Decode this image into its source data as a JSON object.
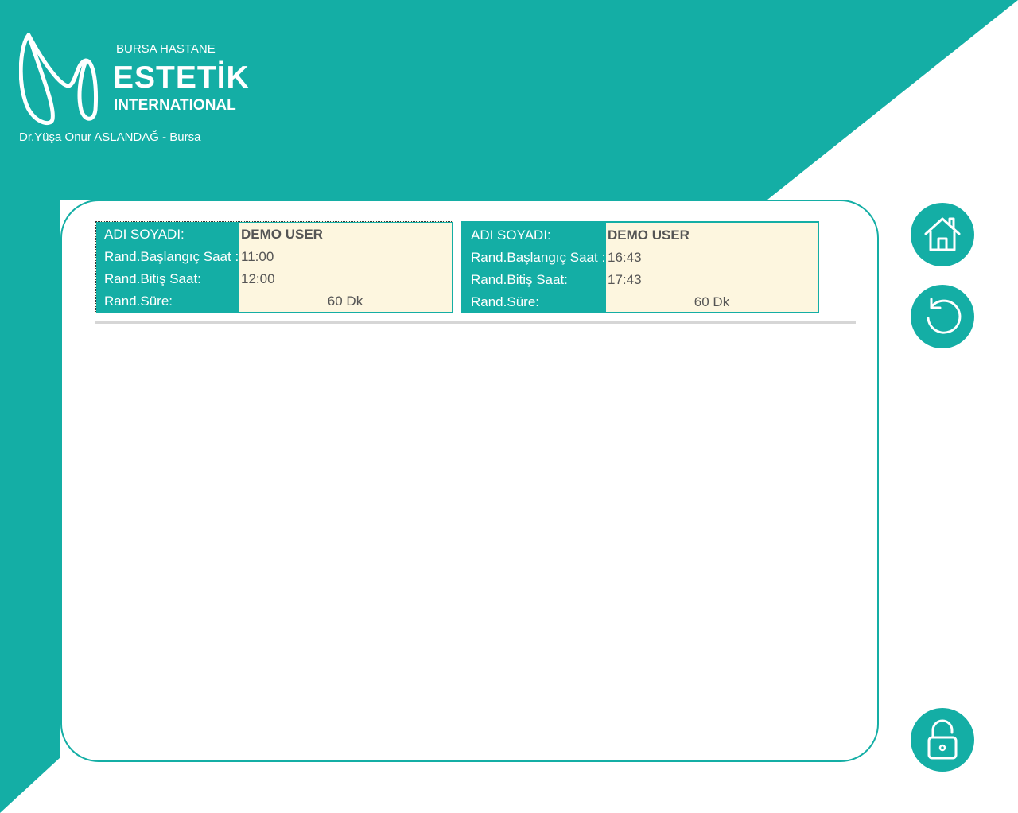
{
  "theme": {
    "primary": "#14aea5",
    "value_bg": "#fdf6df",
    "text_value": "#555555"
  },
  "header": {
    "brand_top": "BURSA HASTANE",
    "brand_main": "ESTETİK",
    "brand_sub": "INTERNATIONAL",
    "doctor": "Dr.Yüşa Onur ASLANDAĞ - Bursa"
  },
  "appointments": [
    {
      "name_label": "ADI SOYADI:",
      "name": "DEMO USER",
      "start_label": "Rand.Başlangıç Saat :",
      "start": "11:00",
      "end_label": "Rand.Bitiş Saat:",
      "end": "12:00",
      "duration_label": "Rand.Süre:",
      "duration": "60 Dk"
    },
    {
      "name_label": "ADI SOYADI:",
      "name": "DEMO USER",
      "start_label": "Rand.Başlangıç Saat :",
      "start": "16:43",
      "end_label": "Rand.Bitiş Saat:",
      "end": "17:43",
      "duration_label": "Rand.Süre:",
      "duration": "60 Dk"
    }
  ],
  "buttons": {
    "home": {
      "icon": "home-icon"
    },
    "refresh": {
      "icon": "refresh-icon"
    },
    "lock": {
      "icon": "unlock-icon"
    }
  }
}
